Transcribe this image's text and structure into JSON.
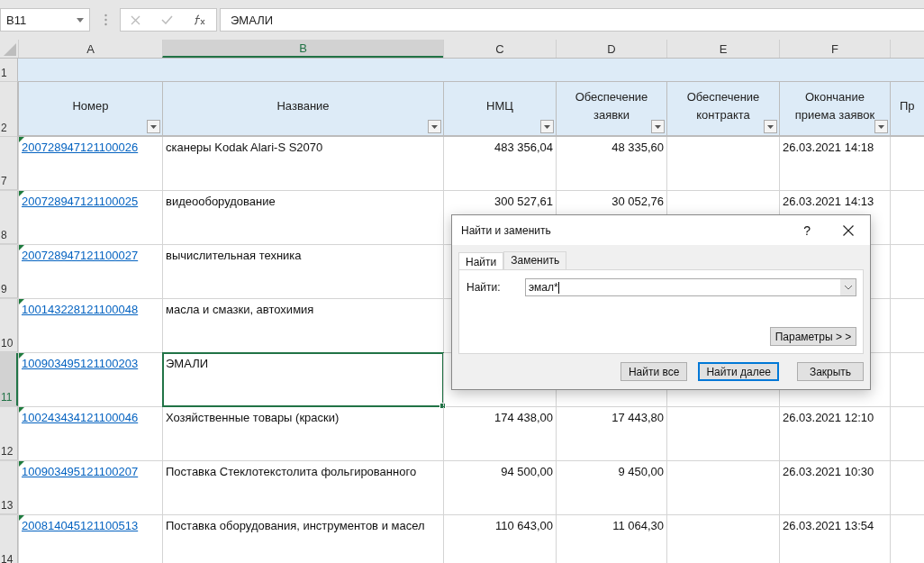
{
  "formula_bar": {
    "name_box": "B11",
    "content": "ЭМАЛИ"
  },
  "columns": [
    {
      "letter": "A",
      "selected": false
    },
    {
      "letter": "B",
      "selected": true
    },
    {
      "letter": "C",
      "selected": false
    },
    {
      "letter": "D",
      "selected": false
    },
    {
      "letter": "E",
      "selected": false
    },
    {
      "letter": "F",
      "selected": false
    }
  ],
  "header_rows": [
    "1",
    "2"
  ],
  "headers": [
    "Номер",
    "Название",
    "НМЦ",
    "Обеспечение заявки",
    "Обеспечение контракта",
    "Окончание приема заявок",
    "Пр"
  ],
  "rows": [
    {
      "number": "7",
      "selected": false,
      "cells": {
        "id": "200728947121100026",
        "name": "сканеры Kodak Alari-S S2070",
        "price": "483 356,04",
        "bid": "48 335,60",
        "deadline": "26.03.2021 14:18"
      }
    },
    {
      "number": "8",
      "selected": false,
      "cells": {
        "id": "200728947121100025",
        "name": "видеооборудование",
        "price": "300 527,61",
        "bid": "30 052,76",
        "deadline": "26.03.2021 14:13"
      }
    },
    {
      "number": "9",
      "selected": false,
      "cells": {
        "id": "200728947121100027",
        "name": "вычислительная техника"
      }
    },
    {
      "number": "10",
      "selected": false,
      "cells": {
        "id": "100143228121100048",
        "name": "масла и смазки, автохимия"
      }
    },
    {
      "number": "11",
      "selected": true,
      "cells": {
        "id": "100903495121100203",
        "name": "ЭМАЛИ"
      }
    },
    {
      "number": "12",
      "selected": false,
      "cells": {
        "id": "100243434121100046",
        "name": "Хозяйственные товары (краски)",
        "price": "174 438,00",
        "bid": "17 443,80",
        "deadline": "26.03.2021 12:10"
      }
    },
    {
      "number": "13",
      "selected": false,
      "cells": {
        "id": "100903495121100207",
        "name": "Поставка Стеклотекстолита фольгированного",
        "price": "94 500,00",
        "bid": "9 450,00",
        "deadline": "26.03.2021 10:30"
      }
    },
    {
      "number": "14",
      "selected": false,
      "cells": {
        "id": "200814045121100513",
        "name": "Поставка оборудования, инструментов и масел",
        "price": "110 643,00",
        "bid": "11 064,30",
        "deadline": "26.03.2021 13:54"
      }
    }
  ],
  "dialog": {
    "title": "Найти и заменить",
    "help": "?",
    "tabs": [
      {
        "label": "Найти",
        "selected": true
      },
      {
        "label": "Заменить",
        "selected": false
      }
    ],
    "find_label": "Найти:",
    "find_value": "эмал*",
    "options_button": "Параметры > >",
    "buttons": [
      {
        "label": "Найти все",
        "default": false
      },
      {
        "label": "Найти далее",
        "default": true
      },
      {
        "label": "Закрыть",
        "default": false
      }
    ]
  }
}
